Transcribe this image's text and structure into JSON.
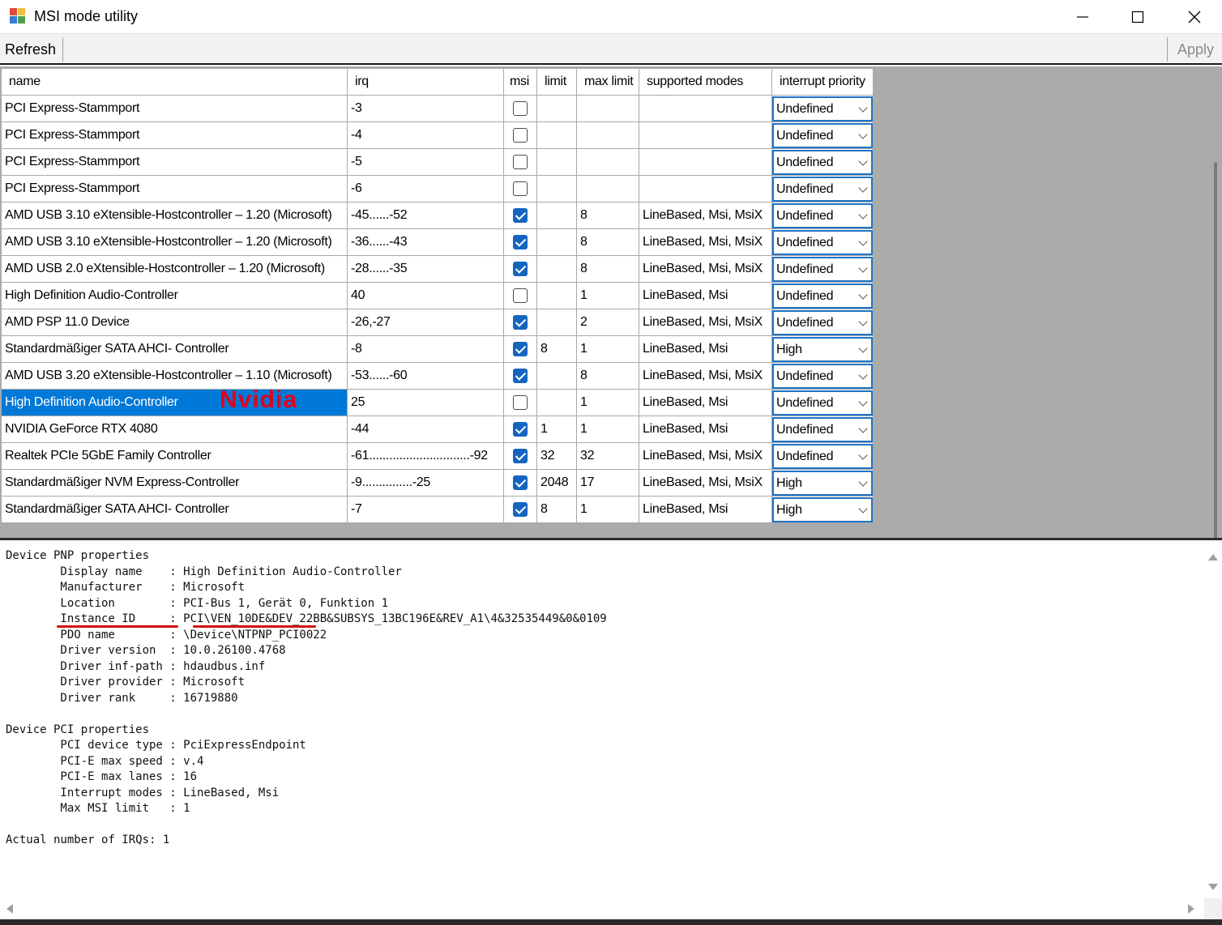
{
  "window": {
    "title": "MSI mode utility",
    "minimize_icon": "minimize-icon",
    "maximize_icon": "maximize-icon",
    "close_icon": "close-icon"
  },
  "toolbar": {
    "refresh_label": "Refresh",
    "apply_label": "Apply"
  },
  "grid": {
    "columns": [
      "name",
      "irq",
      "msi",
      "limit",
      "max limit",
      "supported modes",
      "interrupt priority"
    ],
    "rows": [
      {
        "name": "PCI Express-Stammport",
        "irq": "-3",
        "msi": false,
        "limit": "",
        "max_limit": "",
        "modes": "",
        "priority": "Undefined"
      },
      {
        "name": "PCI Express-Stammport",
        "irq": "-4",
        "msi": false,
        "limit": "",
        "max_limit": "",
        "modes": "",
        "priority": "Undefined"
      },
      {
        "name": "PCI Express-Stammport",
        "irq": "-5",
        "msi": false,
        "limit": "",
        "max_limit": "",
        "modes": "",
        "priority": "Undefined"
      },
      {
        "name": "PCI Express-Stammport",
        "irq": "-6",
        "msi": false,
        "limit": "",
        "max_limit": "",
        "modes": "",
        "priority": "Undefined"
      },
      {
        "name": "AMD USB 3.10 eXtensible-Hostcontroller – 1.20 (Microsoft)",
        "irq": "-45......-52",
        "msi": true,
        "limit": "",
        "max_limit": "8",
        "modes": "LineBased, Msi, MsiX",
        "priority": "Undefined"
      },
      {
        "name": "AMD USB 3.10 eXtensible-Hostcontroller – 1.20 (Microsoft)",
        "irq": "-36......-43",
        "msi": true,
        "limit": "",
        "max_limit": "8",
        "modes": "LineBased, Msi, MsiX",
        "priority": "Undefined"
      },
      {
        "name": "AMD USB 2.0 eXtensible-Hostcontroller – 1.20 (Microsoft)",
        "irq": "-28......-35",
        "msi": true,
        "limit": "",
        "max_limit": "8",
        "modes": "LineBased, Msi, MsiX",
        "priority": "Undefined"
      },
      {
        "name": "High Definition Audio-Controller",
        "irq": "40",
        "msi": false,
        "limit": "",
        "max_limit": "1",
        "modes": "LineBased, Msi",
        "priority": "Undefined"
      },
      {
        "name": "AMD PSP 11.0 Device",
        "irq": "-26,-27",
        "msi": true,
        "limit": "",
        "max_limit": "2",
        "modes": "LineBased, Msi, MsiX",
        "priority": "Undefined"
      },
      {
        "name": "Standardmäßiger SATA AHCI- Controller",
        "irq": "-8",
        "msi": true,
        "limit": "8",
        "max_limit": "1",
        "modes": "LineBased, Msi",
        "priority": "High"
      },
      {
        "name": "AMD USB 3.20 eXtensible-Hostcontroller – 1.10 (Microsoft)",
        "irq": "-53......-60",
        "msi": true,
        "limit": "",
        "max_limit": "8",
        "modes": "LineBased, Msi, MsiX",
        "priority": "Undefined"
      },
      {
        "name": "High Definition Audio-Controller",
        "irq": "25",
        "msi": false,
        "limit": "",
        "max_limit": "1",
        "modes": "LineBased, Msi",
        "priority": "Undefined",
        "selected": true
      },
      {
        "name": "NVIDIA GeForce RTX 4080",
        "irq": "-44",
        "msi": true,
        "limit": "1",
        "max_limit": "1",
        "modes": "LineBased, Msi",
        "priority": "Undefined"
      },
      {
        "name": "Realtek PCIe 5GbE Family Controller",
        "irq": "-61..............................-92",
        "msi": true,
        "limit": "32",
        "max_limit": "32",
        "modes": "LineBased, Msi, MsiX",
        "priority": "Undefined"
      },
      {
        "name": "Standardmäßiger NVM Express-Controller",
        "irq": "-9...............-25",
        "msi": true,
        "limit": "2048",
        "max_limit": "17",
        "modes": "LineBased, Msi, MsiX",
        "priority": "High"
      },
      {
        "name": "Standardmäßiger SATA AHCI- Controller",
        "irq": "-7",
        "msi": true,
        "limit": "8",
        "max_limit": "1",
        "modes": "LineBased, Msi",
        "priority": "High"
      }
    ]
  },
  "annotation": {
    "label": "Nvidia",
    "color": "#e3001b"
  },
  "properties": {
    "lines": [
      "Device PNP properties",
      "        Display name    : High Definition Audio-Controller",
      "        Manufacturer    : Microsoft",
      "        Location        : PCI-Bus 1, Gerät 0, Funktion 1",
      "        Instance ID     : PCI\\VEN_10DE&DEV_22BB&SUBSYS_13BC196E&REV_A1\\4&32535449&0&0109",
      "        PDO name        : \\Device\\NTPNP_PCI0022",
      "        Driver version  : 10.0.26100.4768",
      "        Driver inf-path : hdaudbus.inf",
      "        Driver provider : Microsoft",
      "        Driver rank     : 16719880",
      "",
      "Device PCI properties",
      "        PCI device type : PciExpressEndpoint",
      "        PCI-E max speed : v.4",
      "        PCI-E max lanes : 16",
      "        Interrupt modes : LineBased, Msi",
      "        Max MSI limit   : 1",
      "",
      "Actual number of IRQs: 1"
    ]
  },
  "colors": {
    "selection": "#0078d7",
    "checkbox_checked": "#1565c0",
    "combo_border": "#1f73c8",
    "grid_background": "#ababab"
  }
}
